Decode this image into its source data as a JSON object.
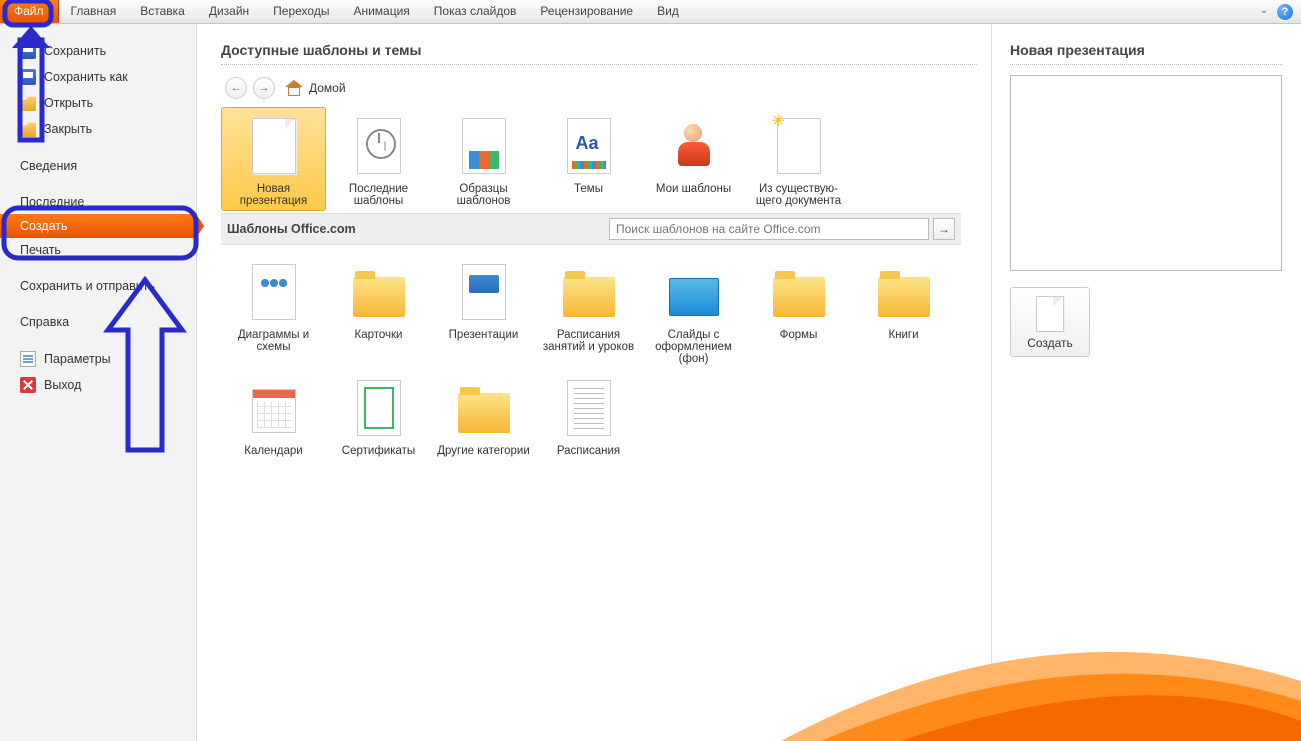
{
  "ribbon": {
    "tabs": [
      "Файл",
      "Главная",
      "Вставка",
      "Дизайн",
      "Переходы",
      "Анимация",
      "Показ слайдов",
      "Рецензирование",
      "Вид"
    ]
  },
  "sidebar": {
    "save": "Сохранить",
    "save_as": "Сохранить как",
    "open": "Открыть",
    "close": "Закрыть",
    "info": "Сведения",
    "recent": "Последние",
    "new": "Создать",
    "print": "Печать",
    "share": "Сохранить и отправить",
    "help": "Справка",
    "options": "Параметры",
    "exit": "Выход"
  },
  "center": {
    "heading": "Доступные шаблоны и темы",
    "home": "Домой",
    "row1": [
      {
        "label": "Новая презентация"
      },
      {
        "label": "Последние шаблоны"
      },
      {
        "label": "Образцы шаблонов"
      },
      {
        "label": "Темы"
      },
      {
        "label": "Мои шаблоны"
      },
      {
        "label": "Из существую-\nщего документа"
      }
    ],
    "officecom_label": "Шаблоны Office.com",
    "search_placeholder": "Поиск шаблонов на сайте Office.com",
    "row2": [
      {
        "label": "Диаграммы и схемы"
      },
      {
        "label": "Карточки"
      },
      {
        "label": "Презентации"
      },
      {
        "label": "Расписания занятий и уроков"
      },
      {
        "label": "Слайды с оформлением (фон)"
      },
      {
        "label": "Формы"
      },
      {
        "label": "Книги"
      }
    ],
    "row3": [
      {
        "label": "Календари"
      },
      {
        "label": "Сертификаты"
      },
      {
        "label": "Другие категории"
      },
      {
        "label": "Расписания"
      }
    ]
  },
  "right": {
    "heading": "Новая презентация",
    "create": "Создать"
  }
}
